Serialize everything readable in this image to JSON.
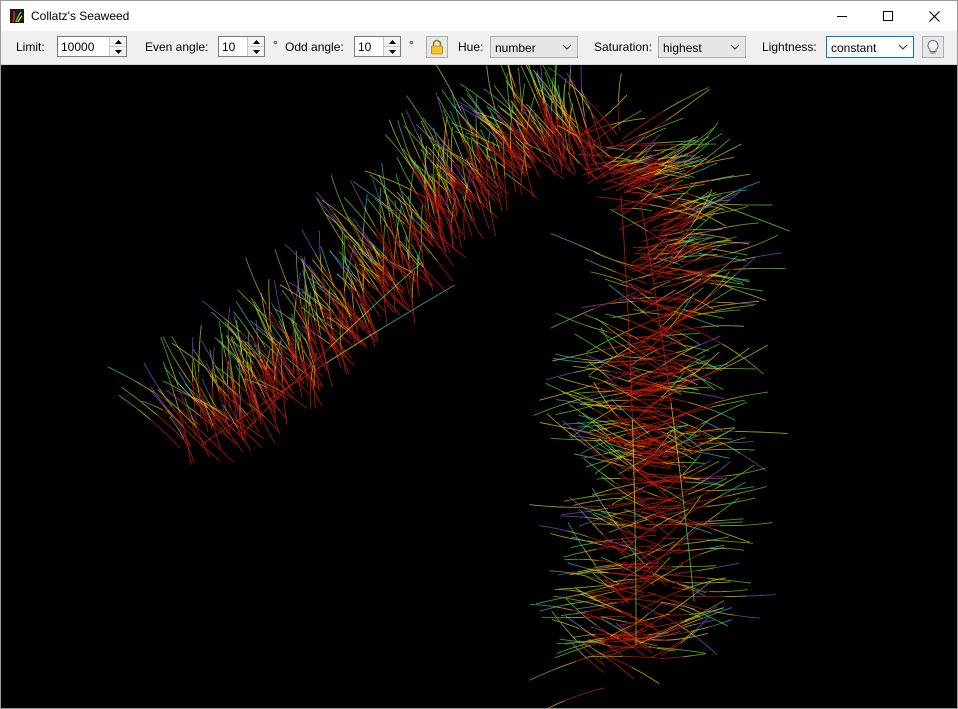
{
  "window": {
    "title": "Collatz's Seaweed"
  },
  "toolbar": {
    "limit_label": "Limit:",
    "limit_value": "10000",
    "even_label": "Even angle:",
    "even_value": "10",
    "degree1": "°",
    "odd_label": "Odd angle:",
    "odd_value": "10",
    "degree2": "°",
    "hue_label": "Hue:",
    "hue_value": "number",
    "saturation_label": "Saturation:",
    "saturation_value": "highest",
    "lightness_label": "Lightness:",
    "lightness_value": "constant"
  },
  "icons": {
    "app": "seaweed-app-icon",
    "lock": "lock-icon",
    "bulb": "lightbulb-icon",
    "minimize": "minimize-icon",
    "maximize": "maximize-icon",
    "close": "close-icon"
  },
  "colors": {
    "canvas_background": "#000000",
    "stem": "#d01e0e",
    "tip_green": "#5ad42a",
    "tip_yellow": "#e2c81c",
    "tip_cyan": "#2ab9c8",
    "tip_purple": "#8c4ad0"
  }
}
